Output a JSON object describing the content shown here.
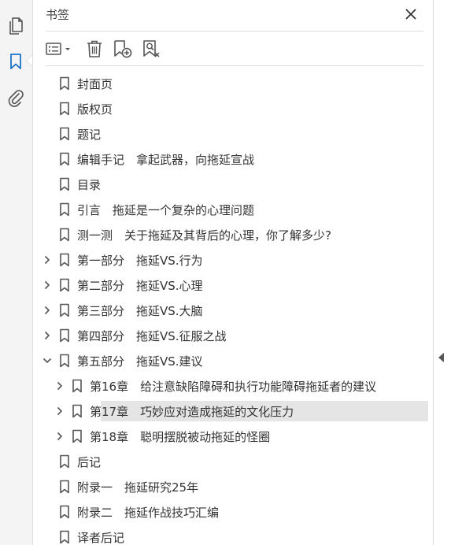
{
  "rail": {
    "items": [
      {
        "name": "pages-icon"
      },
      {
        "name": "bookmark-icon"
      },
      {
        "name": "attachment-icon"
      }
    ],
    "active_color": "#1a73c8"
  },
  "panel": {
    "title": "书签"
  },
  "toolbar": {
    "buttons": [
      "options-menu-icon",
      "delete-icon",
      "add-bookmark-icon",
      "bookmark-search-icon"
    ]
  },
  "tree": {
    "items": [
      {
        "label": "封面页",
        "level": 0,
        "expandable": false,
        "expanded": false
      },
      {
        "label": "版权页",
        "level": 0,
        "expandable": false,
        "expanded": false
      },
      {
        "label": "题记",
        "level": 0,
        "expandable": false,
        "expanded": false
      },
      {
        "label": "编辑手记　拿起武器，向拖延宣战",
        "level": 0,
        "expandable": false,
        "expanded": false
      },
      {
        "label": "目录",
        "level": 0,
        "expandable": false,
        "expanded": false
      },
      {
        "label": "引言　拖延是一个复杂的心理问题",
        "level": 0,
        "expandable": false,
        "expanded": false
      },
      {
        "label": "测一测　关于拖延及其背后的心理，你了解多少?",
        "level": 0,
        "expandable": false,
        "expanded": false
      },
      {
        "label": "第一部分　拖延VS.行为",
        "level": 0,
        "expandable": true,
        "expanded": false
      },
      {
        "label": "第二部分　拖延VS.心理",
        "level": 0,
        "expandable": true,
        "expanded": false
      },
      {
        "label": "第三部分　拖延VS.大脑",
        "level": 0,
        "expandable": true,
        "expanded": false
      },
      {
        "label": "第四部分　拖延VS.征服之战",
        "level": 0,
        "expandable": true,
        "expanded": false
      },
      {
        "label": "第五部分　拖延VS.建议",
        "level": 0,
        "expandable": true,
        "expanded": true
      },
      {
        "label": "第16章　给注意缺陷障碍和执行功能障碍拖延者的建议",
        "level": 1,
        "expandable": true,
        "expanded": false
      },
      {
        "label": "第17章　巧妙应对造成拖延的文化压力",
        "level": 1,
        "expandable": true,
        "expanded": false,
        "selected": true
      },
      {
        "label": "第18章　聪明摆脱被动拖延的怪圈",
        "level": 1,
        "expandable": true,
        "expanded": false
      },
      {
        "label": "后记",
        "level": 0,
        "expandable": false,
        "expanded": false
      },
      {
        "label": "附录一　拖延研究25年",
        "level": 0,
        "expandable": false,
        "expanded": false
      },
      {
        "label": "附录二　拖延作战技巧汇编",
        "level": 0,
        "expandable": false,
        "expanded": false
      },
      {
        "label": "译者后记",
        "level": 0,
        "expandable": false,
        "expanded": false
      }
    ]
  },
  "colors": {
    "icon_gray": "#555555",
    "selected_bg": "#e5e5e5",
    "text": "#333333"
  }
}
